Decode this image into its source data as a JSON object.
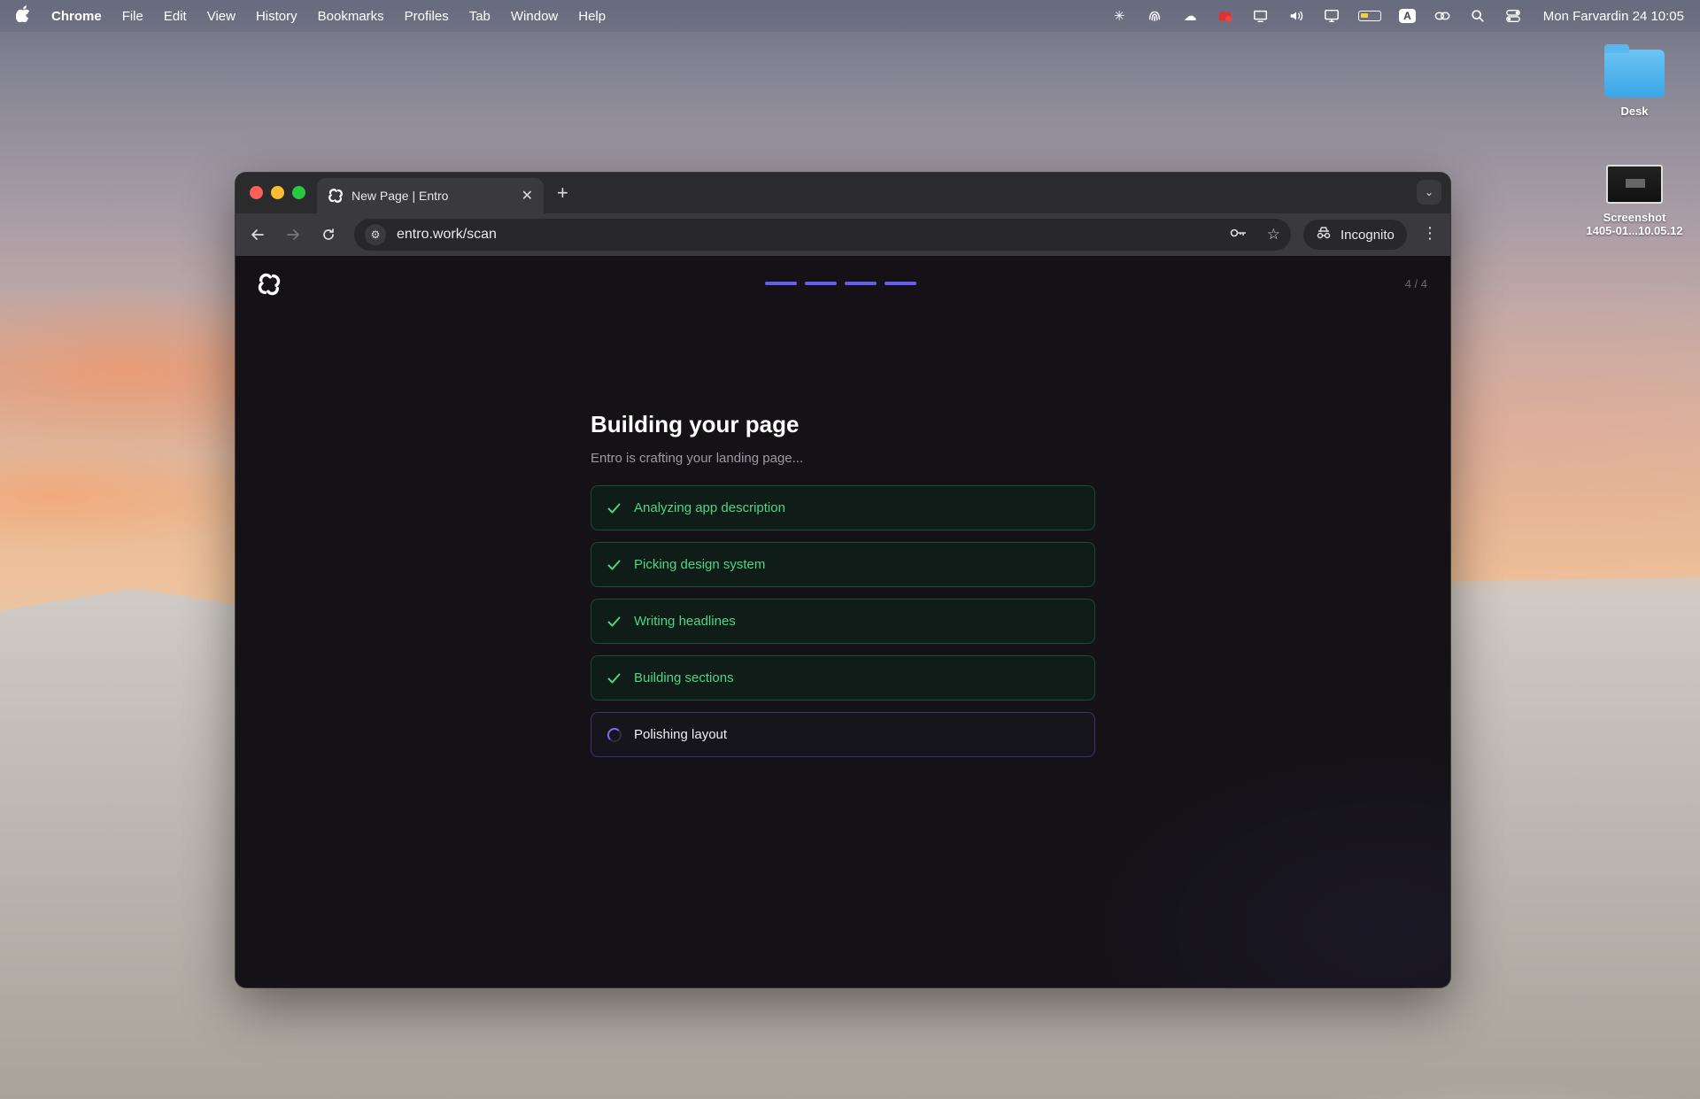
{
  "menubar": {
    "app_name": "Chrome",
    "items": [
      "File",
      "Edit",
      "View",
      "History",
      "Bookmarks",
      "Profiles",
      "Tab",
      "Window",
      "Help"
    ],
    "input_source": "A",
    "clock": "Mon Farvardin 24  10:05"
  },
  "desktop": {
    "folder_label": "Desk",
    "screenshot_label_line1": "Screenshot",
    "screenshot_label_line2": "1405-01...10.05.12"
  },
  "browser": {
    "tab_title": "New Page | Entro",
    "url": "entro.work/scan",
    "incognito_label": "Incognito"
  },
  "page": {
    "step_indicator": "4 / 4",
    "progress_segments": 4,
    "accent": "#6b5cf0",
    "success_color": "#4ed587",
    "title": "Building your page",
    "subtitle": "Entro is crafting your landing page...",
    "tasks": [
      {
        "label": "Analyzing app description",
        "status": "done"
      },
      {
        "label": "Picking design system",
        "status": "done"
      },
      {
        "label": "Writing headlines",
        "status": "done"
      },
      {
        "label": "Building sections",
        "status": "done"
      },
      {
        "label": "Polishing layout",
        "status": "in-progress"
      }
    ]
  }
}
